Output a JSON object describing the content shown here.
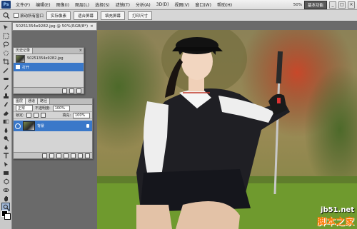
{
  "app": {
    "logo": "Ps"
  },
  "menubar": {
    "items": [
      "文件(F)",
      "编辑(E)",
      "图像(I)",
      "图层(L)",
      "选择(S)",
      "滤镜(T)",
      "分析(A)",
      "3D(D)",
      "视图(V)",
      "窗口(W)",
      "帮助(H)"
    ],
    "zoom": "50%",
    "workspace": "基本功能",
    "win_controls": [
      "_",
      "□",
      "×"
    ]
  },
  "options": {
    "checkbox_label": "滚动所有窗口",
    "buttons": [
      "实际像素",
      "适合屏幕",
      "填充屏幕",
      "打印尺寸"
    ]
  },
  "document": {
    "tab_title": "50251354e9282.jpg @ 50%(RGB/8*)",
    "close": "×"
  },
  "history_panel": {
    "tab": "历史记录",
    "close": "×",
    "snapshot_label": "50251354e9282.jpg",
    "steps": [
      "打开"
    ]
  },
  "layers_panel": {
    "tabs": [
      "图层",
      "通道",
      "路径"
    ],
    "blend_mode": "正常",
    "opacity_label": "不透明度:",
    "opacity": "100%",
    "lock_label": "锁定:",
    "fill_label": "填充:",
    "fill": "100%",
    "layers": [
      {
        "name": "背景"
      }
    ]
  },
  "toolbar": {
    "tools": [
      "move-tool",
      "marquee-tool",
      "lasso-tool",
      "quick-select-tool",
      "crop-tool",
      "eyedropper-tool",
      "healing-brush-tool",
      "brush-tool",
      "clone-stamp-tool",
      "history-brush-tool",
      "eraser-tool",
      "gradient-tool",
      "blur-tool",
      "dodge-tool",
      "pen-tool",
      "type-tool",
      "path-select-tool",
      "shape-tool",
      "3d-rotate-tool",
      "3d-orbit-tool",
      "hand-tool",
      "zoom-tool"
    ]
  },
  "watermark": {
    "url": "jb51.net",
    "site": "脚本之家"
  }
}
